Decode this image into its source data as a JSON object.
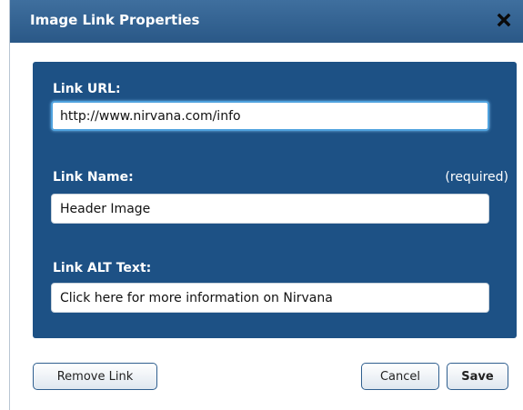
{
  "dialog": {
    "title": "Image Link Properties",
    "close_icon": "close-icon"
  },
  "fields": {
    "url": {
      "label": "Link URL:",
      "value": "http://www.nirvana.com/info"
    },
    "name": {
      "label": "Link Name:",
      "note": "(required)",
      "value": "Header Image"
    },
    "alt": {
      "label": "Link ALT Text:",
      "value": "Click here for more information on Nirvana"
    }
  },
  "buttons": {
    "remove": "Remove Link",
    "cancel": "Cancel",
    "save": "Save"
  },
  "colors": {
    "titlebar": "#2f5f8f",
    "panel": "#1d5185",
    "focus_ring": "#4fa2de"
  }
}
